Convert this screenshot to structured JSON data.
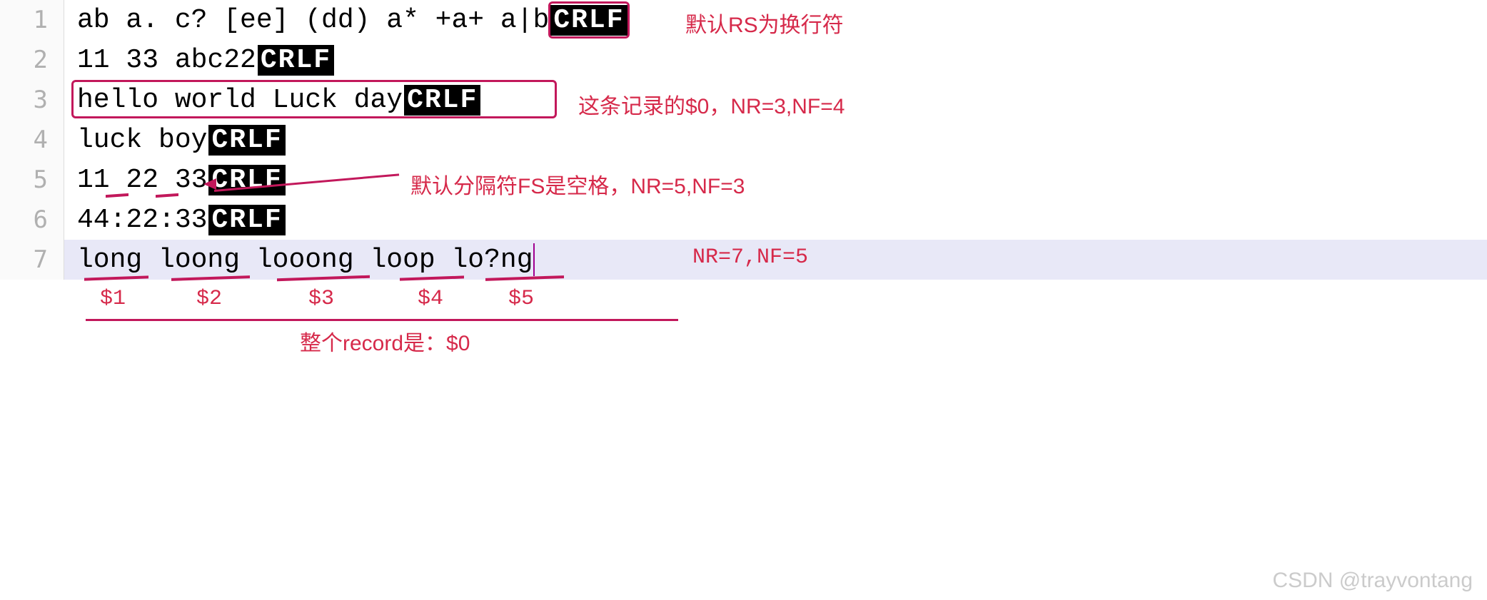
{
  "crlf_label": "CRLF",
  "lines": [
    {
      "num": "1",
      "text": "ab a. c? [ee] (dd) a* +a+ a|b",
      "crlf": true
    },
    {
      "num": "2",
      "text": "11 33 abc22",
      "crlf": true
    },
    {
      "num": "3",
      "text": "hello world Luck day",
      "crlf": true
    },
    {
      "num": "4",
      "text": "luck boy",
      "crlf": true
    },
    {
      "num": "5",
      "text": "11 22 33",
      "crlf": true
    },
    {
      "num": "6",
      "text": "44:22:33",
      "crlf": true
    },
    {
      "num": "7",
      "text": "long loong looong loop lo?ng",
      "crlf": false
    }
  ],
  "annotations": {
    "a1": "默认RS为换行符",
    "a2": "这条记录的$0，NR=3,NF=4",
    "a3": "默认分隔符FS是空格，NR=5,NF=3",
    "a4": "NR=7,NF=5",
    "f1": "$1",
    "f2": "$2",
    "f3": "$3",
    "f4": "$4",
    "f5": "$5",
    "rec": "整个record是：$0"
  },
  "watermark": "CSDN @trayvontang"
}
